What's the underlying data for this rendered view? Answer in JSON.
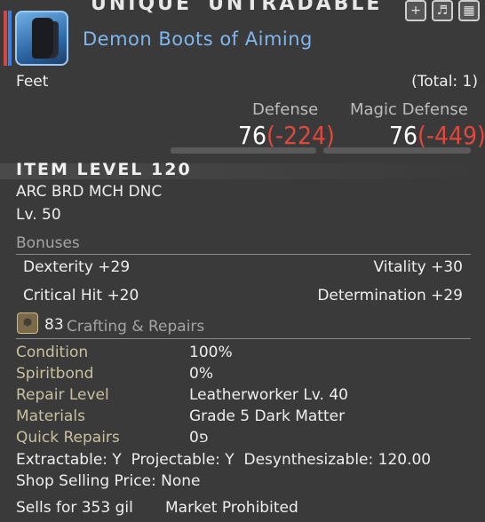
{
  "header": {
    "tag_unique": "UNIQUE",
    "tag_untradable": "UNTRADABLE",
    "item_name": "Demon Boots of Aiming",
    "slot": "Feet",
    "total": "(Total: 1)"
  },
  "stats": {
    "defense_label": "Defense",
    "defense_value": "76",
    "defense_diff": "(-224)",
    "magic_defense_label": "Magic Defense",
    "magic_defense_value": "76",
    "magic_defense_diff": "(-449)"
  },
  "item_level": "ITEM LEVEL 120",
  "classes": "ARC BRD MCH DNC",
  "level": "Lv. 50",
  "bonuses": {
    "title": "Bonuses",
    "dexterity": "Dexterity +29",
    "vitality": "Vitality +30",
    "critical_hit": "Critical Hit +20",
    "determination": "Determination +29"
  },
  "crafting": {
    "number": "83",
    "title": "Crafting & Repairs",
    "rows": [
      {
        "label": "Condition",
        "value": "100%"
      },
      {
        "label": "Spiritbond",
        "value": "0%"
      },
      {
        "label": "Repair Level",
        "value": "Leatherworker Lv. 40"
      },
      {
        "label": "Materials",
        "value": "Grade 5 Dark Matter"
      },
      {
        "label": "Quick Repairs",
        "value": "0פ"
      }
    ]
  },
  "footer": {
    "extractable": "Extractable: Y  Projectable: Y  Desynthesizable: 120.00",
    "shop_price": "Shop Selling Price: None",
    "sells_for": "Sells for 353 gil",
    "market": "Market Prohibited"
  },
  "colors": {
    "name_blue": "#7fb6f0",
    "diff_red": "#e0483e",
    "background": "#3a3a3a"
  },
  "icons": [
    "plus-icon",
    "glamour-icon",
    "armoire-icon",
    "materia-icon",
    "boots-icon"
  ]
}
